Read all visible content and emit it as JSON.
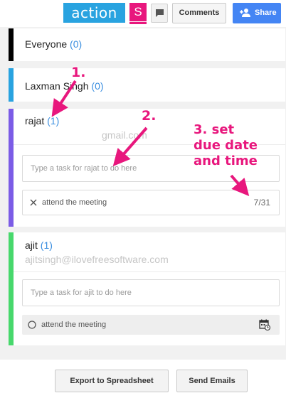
{
  "header": {
    "logo": "action",
    "s_button": "S",
    "comments_label": "Comments",
    "share_label": "Share",
    "colors": {
      "logo_bg": "#29a3e0",
      "s_bg": "#e8177d",
      "share_bg": "#4485f4"
    }
  },
  "groups": [
    {
      "name": "Everyone",
      "count": "(0)",
      "bar_color": "#000000"
    },
    {
      "name": "Laxman Singh",
      "count": "(0)",
      "bar_color": "#29a3e0"
    },
    {
      "name": "rajat",
      "count": "(1)",
      "bar_color": "#7b5ce6",
      "email": "gmail.com",
      "task_placeholder": "Type a task for rajat to do here",
      "task": {
        "label": "attend the meeting",
        "due": "7/31",
        "icon": "close-icon"
      }
    },
    {
      "name": "ajit",
      "count": "(1)",
      "bar_color": "#47d86c",
      "email": "ajitsingh@ilovefreesoftware.com",
      "task_placeholder": "Type a task for ajit to do here",
      "task": {
        "label": "attend the meeting",
        "icon": "circle-icon",
        "action_icon": "calendar-icon"
      }
    }
  ],
  "footer": {
    "export_label": "Export to Spreadsheet",
    "send_label": "Send Emails"
  },
  "annotations": {
    "step1": "1.",
    "step2": "2.",
    "step3_line1": "3. set",
    "step3_line2": "due date",
    "step3_line3": "and time",
    "color": "#e8177d"
  }
}
